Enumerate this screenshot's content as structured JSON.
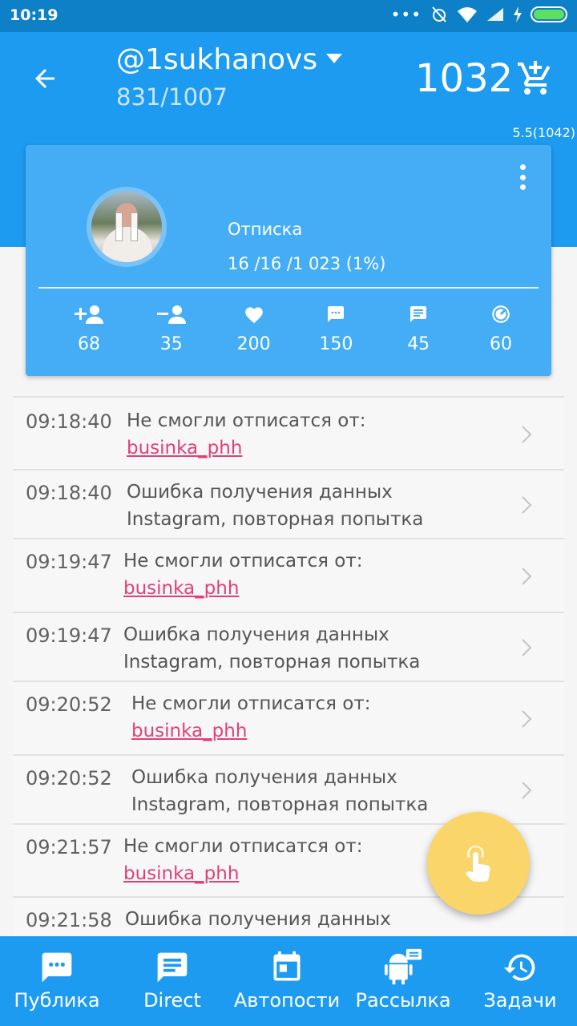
{
  "status_bar": {
    "time": "10:19"
  },
  "header": {
    "account": "@1sukhanovs",
    "counts": "831/1007",
    "balance": "1032",
    "version": "5.5(1042)"
  },
  "card": {
    "task_title": "Отписка",
    "task_progress": "16 /16 /1 023 (1%)",
    "stats": [
      {
        "icon": "follow-icon",
        "value": "68"
      },
      {
        "icon": "unfollow-icon",
        "value": "35"
      },
      {
        "icon": "like-icon",
        "value": "200"
      },
      {
        "icon": "comment-icon",
        "value": "150"
      },
      {
        "icon": "message-icon",
        "value": "45"
      },
      {
        "icon": "speedometer-icon",
        "value": "60"
      }
    ]
  },
  "log": [
    {
      "time": "09:18:40",
      "line1": "Не смогли отписатся от:",
      "link": "businka_phh"
    },
    {
      "time": "09:18:40",
      "line1": "Ошибка получения данных",
      "line2": "Instagram, повторная попытка"
    },
    {
      "time": "09:19:47",
      "line1": "Не смогли отписатся от:",
      "link": "businka_phh"
    },
    {
      "time": "09:19:47",
      "line1": "Ошибка получения данных",
      "line2": "Instagram, повторная попытка"
    },
    {
      "time": "09:20:52",
      "line1": "Не смогли отписатся от:",
      "link": "businka_phh"
    },
    {
      "time": "09:20:52",
      "line1": "Ошибка получения данных",
      "line2": "Instagram, повторная попытка"
    },
    {
      "time": "09:21:57",
      "line1": "Не смогли отписатся от:",
      "link": "businka_phh"
    },
    {
      "time": "09:21:58",
      "line1": "Ошибка получения данных"
    }
  ],
  "bottom_nav": [
    {
      "label": "Публика",
      "icon": "audience-chat-icon"
    },
    {
      "label": "Direct",
      "icon": "direct-message-icon"
    },
    {
      "label": "Автопости",
      "icon": "calendar-icon"
    },
    {
      "label": "Рассылка",
      "icon": "android-icon"
    },
    {
      "label": "Задачи",
      "icon": "history-icon"
    }
  ],
  "colors": {
    "primary": "#1d9bf0",
    "status_bar": "#0d80c8",
    "card": "#44adf5",
    "link": "#e0407a",
    "fab": "#f9d56a"
  }
}
